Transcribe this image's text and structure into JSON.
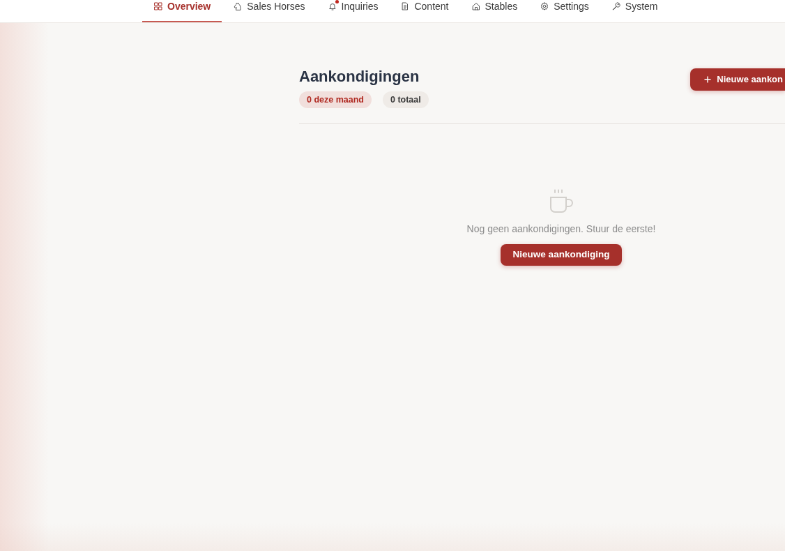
{
  "nav": {
    "tabs": [
      {
        "label": "Overview",
        "selected": true,
        "unread": false
      },
      {
        "label": "Sales Horses",
        "selected": false,
        "unread": false
      },
      {
        "label": "Inquiries",
        "selected": false,
        "unread": true
      },
      {
        "label": "Content",
        "selected": false,
        "unread": false
      },
      {
        "label": "Stables",
        "selected": false,
        "unread": false
      },
      {
        "label": "Settings",
        "selected": false,
        "unread": false
      },
      {
        "label": "System",
        "selected": false,
        "unread": false
      }
    ]
  },
  "page": {
    "title": "Aankondigingen",
    "badges": [
      {
        "label": "0 deze maand",
        "kind": "accent"
      },
      {
        "label": "0 totaal",
        "kind": "neutral"
      }
    ],
    "new_button": {
      "label": "Nieuwe aankon"
    }
  },
  "empty_state": {
    "message": "Nog geen aankondigingen. Stuur de eerste!",
    "button": {
      "label": "Nieuwe aankondiging"
    }
  }
}
